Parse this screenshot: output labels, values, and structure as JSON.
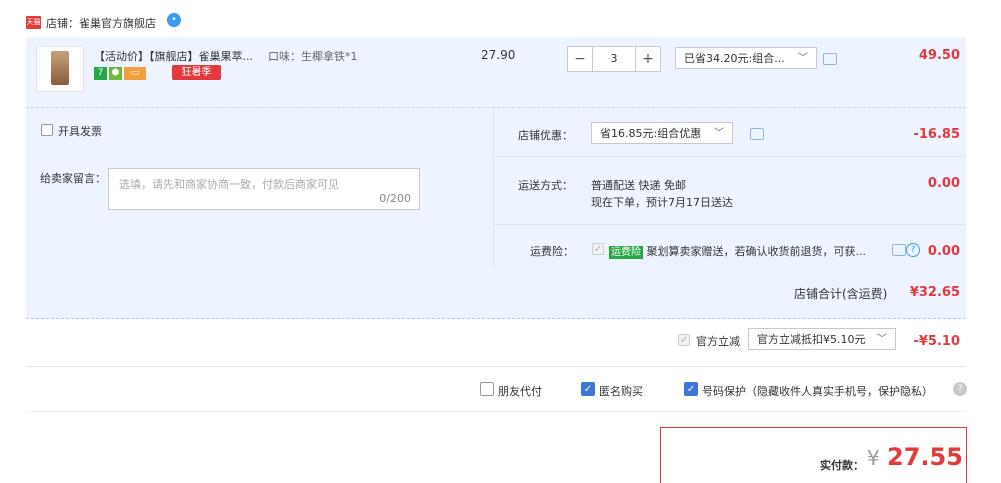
{
  "store": {
    "badge": "天猫",
    "name": "店铺：雀巢官方旗舰店",
    "ww_icon": "im-icon"
  },
  "item": {
    "title": "【活动价】【旗舰店】雀巢果萃...",
    "variant": "口味：生椰拿铁*1",
    "badges": [
      "7",
      "shield",
      "card"
    ],
    "promo_tag": "狂暑季",
    "unit_price": "27.90",
    "quantity": "3",
    "minus": "−",
    "plus": "+",
    "discount_select": "已省34.20元:组合...",
    "subtotal": "49.50"
  },
  "invoice": {
    "label": "开具发票"
  },
  "message": {
    "label": "给卖家留言：",
    "placeholder": "选填，请先和商家协商一致，付款后商家可见",
    "count": "0/200"
  },
  "store_discount": {
    "label": "店铺优惠：",
    "select": "省16.85元:组合优惠",
    "amount": "-16.85"
  },
  "shipping": {
    "label": "运送方式：",
    "method": "普通配送 快递 免邮",
    "eta": "现在下单，预计7月17日送达",
    "amount": "0.00"
  },
  "insurance": {
    "label": "运费险：",
    "tag": "运费险",
    "text": "聚划算卖家赠送，若确认收货前退货，可获...",
    "amount": "0.00"
  },
  "store_total": {
    "label": "店铺合计(含运费)",
    "amount": "¥32.65"
  },
  "official": {
    "label": "官方立减",
    "select": "官方立减抵扣¥5.10元",
    "amount": "-¥5.10"
  },
  "options": {
    "friend_pay": "朋友代付",
    "anonymous": "匿名购买",
    "phone_protect": "号码保护（隐藏收件人真实手机号，保护隐私）"
  },
  "pay": {
    "label": "实付款：",
    "currency": "¥",
    "amount": "27.55"
  },
  "colors": {
    "accent_red": "#e4393c",
    "panel_blue": "#eef4ff",
    "check_blue": "#3c77d8"
  }
}
